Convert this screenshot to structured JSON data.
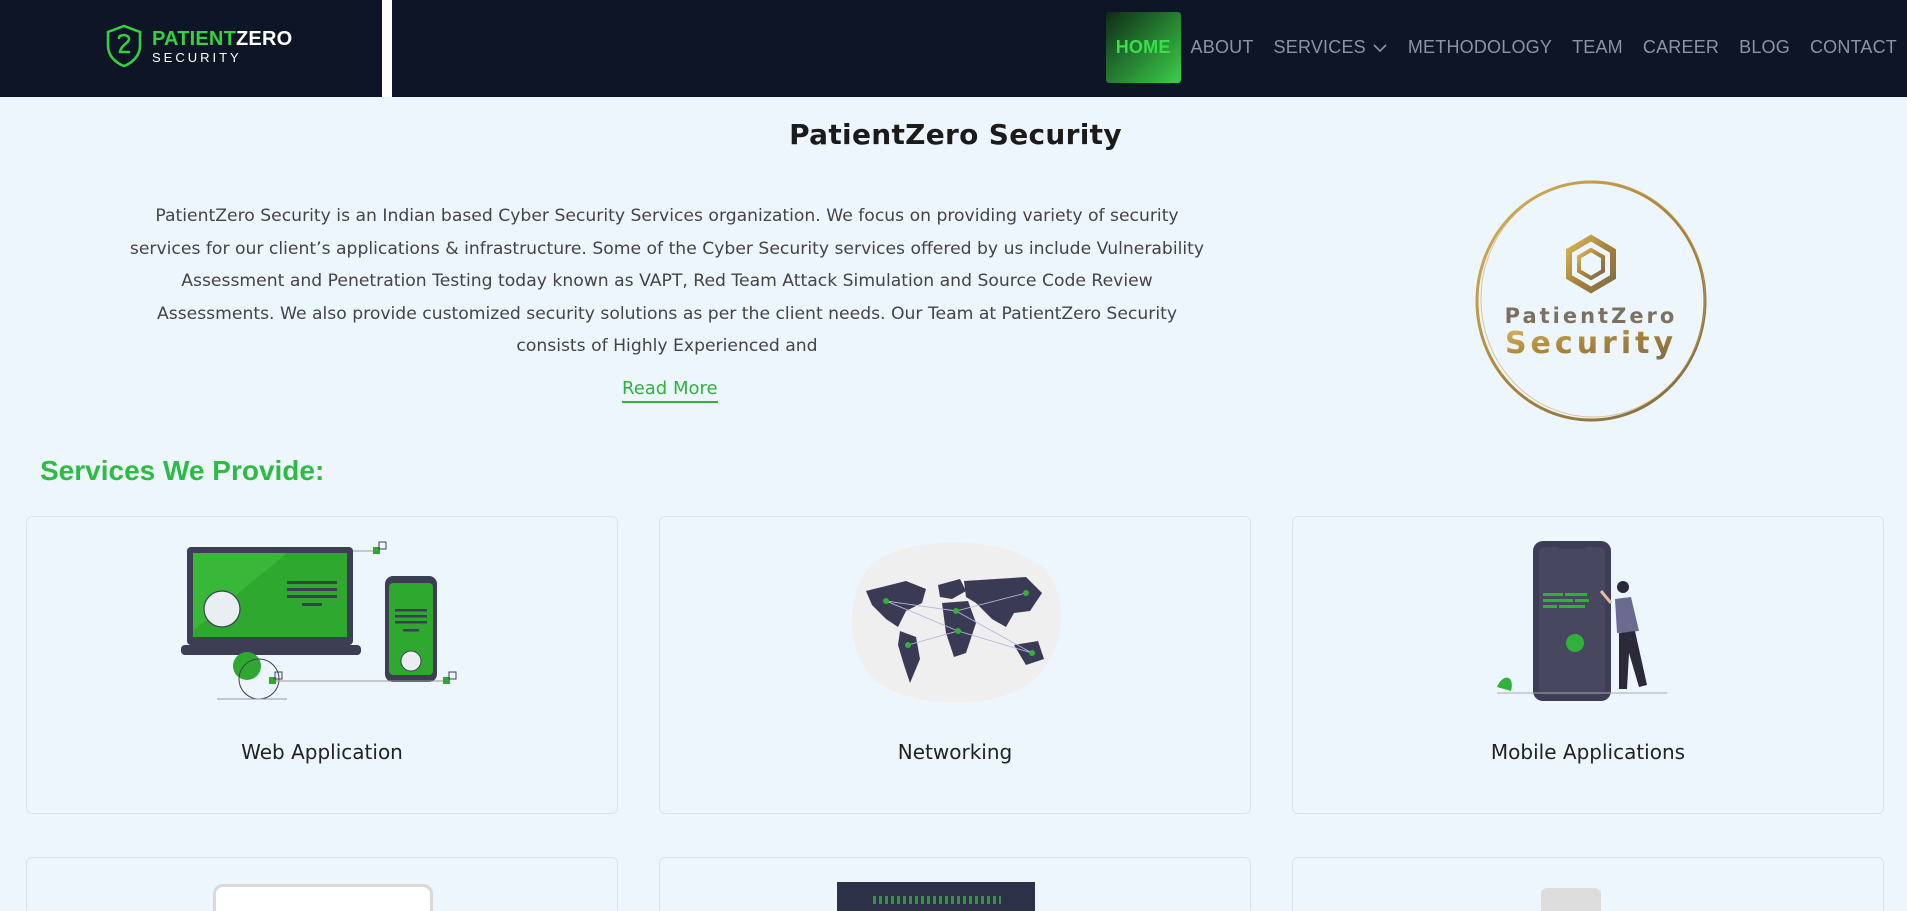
{
  "header": {
    "logo": {
      "primary": "PATIENT",
      "secondary": "ZERO",
      "tagline": "SECURITY"
    },
    "nav": [
      {
        "label": "HOME",
        "active": true
      },
      {
        "label": "ABOUT"
      },
      {
        "label": "SERVICES",
        "has_dropdown": true
      },
      {
        "label": "METHODOLOGY"
      },
      {
        "label": "TEAM"
      },
      {
        "label": "CAREER"
      },
      {
        "label": "BLOG"
      },
      {
        "label": "CONTACT"
      }
    ]
  },
  "intro": {
    "title": "PatientZero Security",
    "body": "PatientZero Security is an Indian based Cyber Security Services organization. We focus on providing variety of security services for our client’s applications & infrastructure. Some of the Cyber Security services offered by us include Vulnerability Assessment and Penetration Testing today known as VAPT, Red Team Attack Simulation and Source Code Review Assessments. We also provide customized security solutions as per the client needs. Our Team at PatientZero Security consists of Highly Experienced and",
    "read_more": "Read More",
    "emblem": {
      "line1": "PatientZero",
      "line2": "Security"
    }
  },
  "services": {
    "heading": "Services We Provide:",
    "cards": [
      {
        "label": "Web Application",
        "icon": "web-application-illustration"
      },
      {
        "label": "Networking",
        "icon": "world-map-illustration"
      },
      {
        "label": "Mobile Applications",
        "icon": "mobile-phone-illustration"
      }
    ]
  },
  "colors": {
    "accent": "#2dbb44",
    "header_bg": "#0d1526",
    "page_bg": "#eef6fd"
  }
}
